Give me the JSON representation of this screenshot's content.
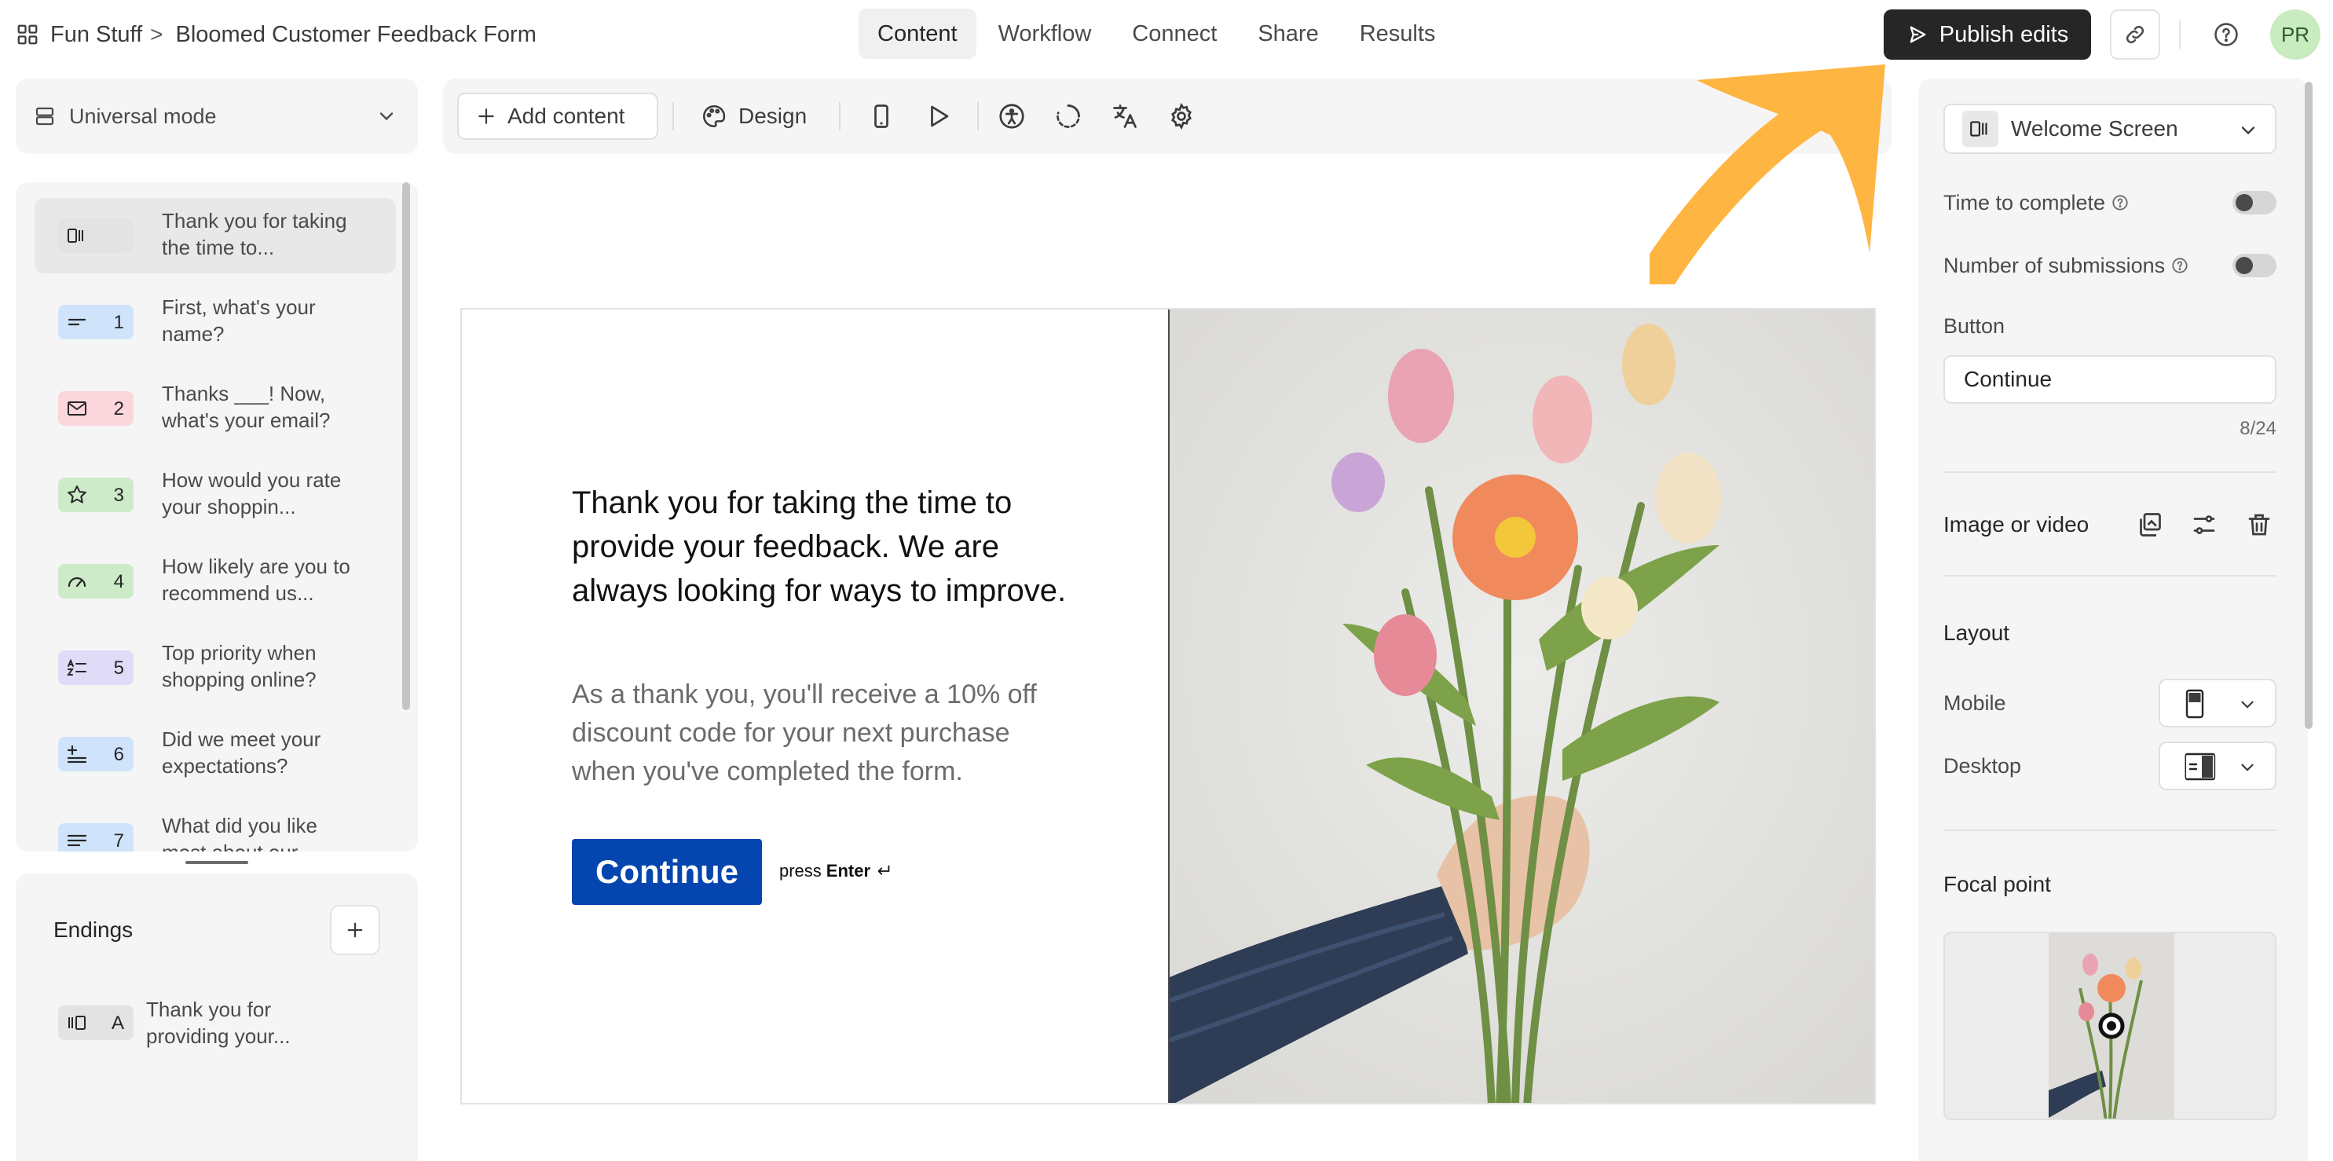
{
  "header": {
    "workspace": "Fun Stuff",
    "separator": ">",
    "form_title": "Bloomed Customer Feedback Form",
    "tabs": [
      {
        "label": "Content",
        "active": true
      },
      {
        "label": "Workflow",
        "active": false
      },
      {
        "label": "Connect",
        "active": false
      },
      {
        "label": "Share",
        "active": false
      },
      {
        "label": "Results",
        "active": false
      }
    ],
    "publish_label": "Publish edits",
    "avatar_initials": "PR",
    "icons": [
      "grid-icon",
      "send-icon",
      "link-icon",
      "help-circle-icon"
    ]
  },
  "sidebar": {
    "mode_label": "Universal mode",
    "questions": [
      {
        "number": "",
        "icon": "welcome-screen-icon",
        "color": "#e3e3e3",
        "text": "Thank you for taking the time to..."
      },
      {
        "number": "1",
        "icon": "short-text-icon",
        "color": "#cfe4fb",
        "text": "First, what's your name?"
      },
      {
        "number": "2",
        "icon": "email-icon",
        "color": "#fbd6dc",
        "text": "Thanks ___! Now, what's your email?"
      },
      {
        "number": "3",
        "icon": "star-icon",
        "color": "#cdebc8",
        "text": "How would you rate your shoppin..."
      },
      {
        "number": "4",
        "icon": "gauge-icon",
        "color": "#cdebc8",
        "text": "How likely are you to recommend us..."
      },
      {
        "number": "5",
        "icon": "ranking-icon",
        "color": "#e0dcf8",
        "text": "Top priority when shopping online?"
      },
      {
        "number": "6",
        "icon": "opinion-scale-icon",
        "color": "#cfe4fb",
        "text": "Did we meet your expectations?"
      },
      {
        "number": "7",
        "icon": "long-text-icon",
        "color": "#cfe4fb",
        "text": "What did you like most about our..."
      }
    ],
    "endings_title": "Endings",
    "endings": [
      {
        "letter": "A",
        "icon": "end-screen-icon",
        "color": "#e3e3e3",
        "text": "Thank you for providing your..."
      }
    ]
  },
  "toolbar": {
    "add_content_label": "Add content",
    "design_label": "Design",
    "icons": [
      "mobile-preview-icon",
      "play-icon",
      "accessibility-icon",
      "loading-icon",
      "translate-icon",
      "settings-icon"
    ]
  },
  "preview": {
    "headline": "Thank you for taking the time to provide your feedback. We are always looking for ways to improve.",
    "subtext": "As a thank you, you'll receive a 10% off discount code for your next purchase when you've completed the form.",
    "button_label": "Continue",
    "press_label": "press",
    "enter_label": "Enter",
    "button_color": "#0445af"
  },
  "right_panel": {
    "screen_select": "Welcome Screen",
    "time_to_complete_label": "Time to complete",
    "time_to_complete_on": false,
    "submissions_label": "Number of submissions",
    "submissions_on": false,
    "button_section_label": "Button",
    "button_value": "Continue",
    "char_count": "8/24",
    "image_label": "Image or video",
    "layout_title": "Layout",
    "mobile_label": "Mobile",
    "desktop_label": "Desktop",
    "focal_title": "Focal point"
  },
  "colors": {
    "publish_bg": "#262627",
    "arrow": "#ffb541",
    "avatar_bg": "#c8ecc0"
  }
}
